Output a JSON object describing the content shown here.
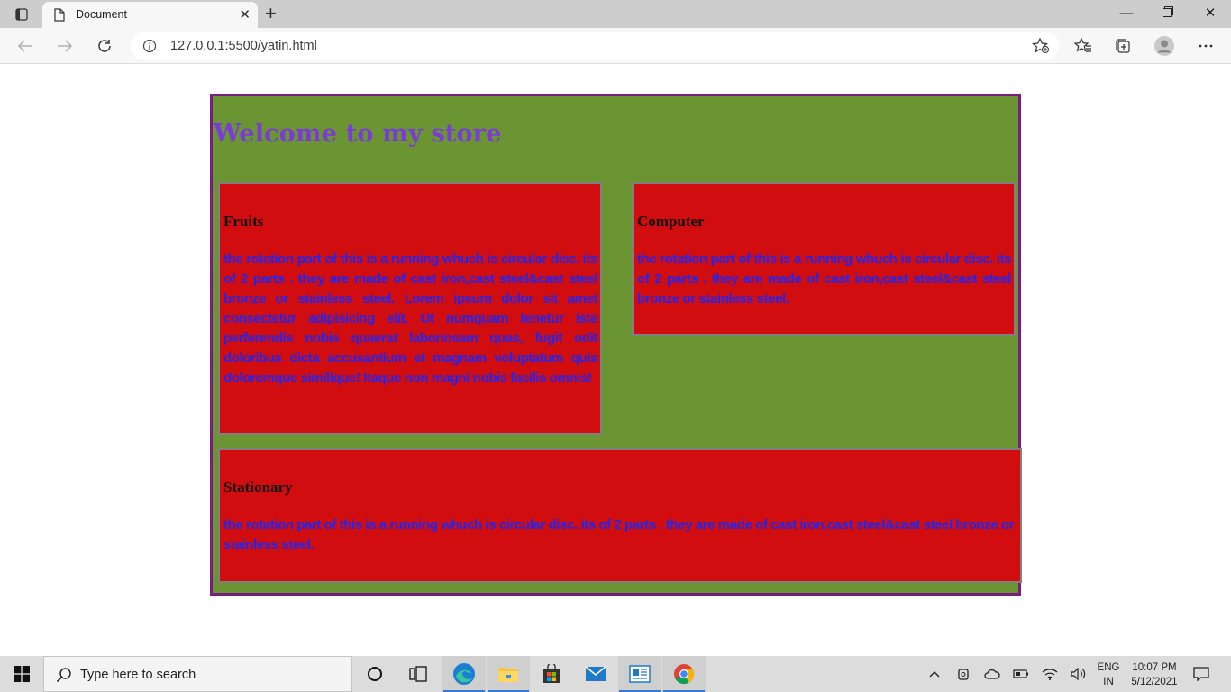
{
  "browser": {
    "tab_title": "Document",
    "url": "127.0.0.1:5500/yatin.html"
  },
  "page": {
    "heading": "Welcome to my store",
    "cards": [
      {
        "title": "Fruits",
        "text": "the rotation part of this is a running whuch is circular disc. its of 2 parts . they are made of cast iron,cast steel&cast steel bronze or stainless steel. Lorem ipsum dolor sit amet consectetur adipisicing elit. Ut numquam tenetur iste perferendis nobis quaerat laboriosam quas, fugit odit doloribus dicta accusantium et magnam voluptatum quis doloremque similique! Itaque non magni nobis facilis omnis!"
      },
      {
        "title": "Computer",
        "text": "the rotation part of this is a running whuch is circular disc. its of 2 parts . they are made of cast iron,cast steel&cast steel bronze or stainless steel."
      },
      {
        "title": "Stationary",
        "text": "the rotation part of this is a running whuch is circular disc. its of 2 parts . they are made of cast iron,cast steel&cast steel bronze or stainless steel."
      }
    ],
    "colors": {
      "store_bg": "#6b9432",
      "store_border": "#7a1d82",
      "heading": "#7b3bd8",
      "card_bg": "#d20d10",
      "card_text": "#2424ea"
    }
  },
  "taskbar": {
    "search_placeholder": "Type here to search",
    "lang_top": "ENG",
    "lang_bottom": "IN",
    "time": "10:07 PM",
    "date": "5/12/2021"
  }
}
